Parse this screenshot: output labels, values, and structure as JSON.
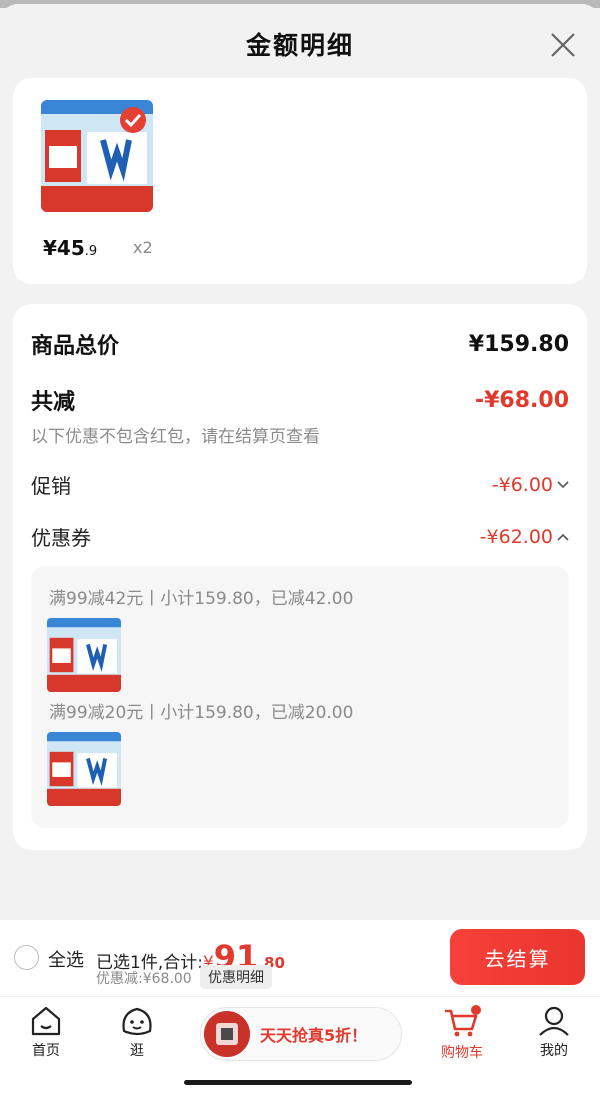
{
  "header": {
    "title": "金额明细"
  },
  "product": {
    "price_main": "¥45",
    "price_decimal": ".9",
    "quantity": "x2",
    "thumb_icon": "milk-product-thumbnail"
  },
  "summary": {
    "total_label": "商品总价",
    "total_value": "¥159.80",
    "reduce_label": "共减",
    "reduce_value": "-¥68.00",
    "hint": "以下优惠不包含红包，请在结算页查看",
    "promo_label": "促销",
    "promo_value": "-¥6.00",
    "coupon_label": "优惠券",
    "coupon_value": "-¥62.00",
    "coupons": [
      {
        "text": "满99减42元丨小计159.80，已减42.00"
      },
      {
        "text": "满99减20元丨小计159.80，已减20.00"
      }
    ]
  },
  "checkout": {
    "select_all": "全选",
    "selected_prefix": "已选1件,合计:",
    "total_currency": "¥",
    "total_integer": "91",
    "total_decimal": ".80",
    "discount_text": "优惠减:¥68.00",
    "detail_chip": "优惠明细",
    "checkout_button": "去结算"
  },
  "tabbar": {
    "home": "首页",
    "browse": "逛",
    "promo": "天天抢真5折！",
    "cart": "购物车",
    "me": "我的"
  },
  "colors": {
    "accent_red": "#e2392d",
    "background": "#f2f2f2"
  }
}
